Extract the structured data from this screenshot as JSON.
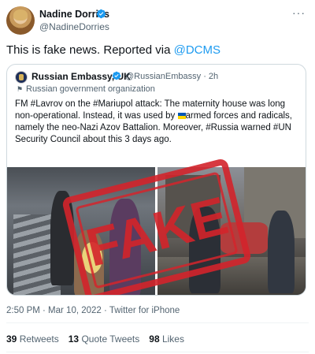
{
  "author": {
    "name": "Nadine Dorries",
    "handle": "@NadineDorries"
  },
  "tweet": {
    "text_before_mention": "This is fake news. Reported via ",
    "mention": "@DCMS"
  },
  "quoted_tweet": {
    "name": "Russian Embassy, UK",
    "handle_time": "@RussianEmbassy · 2h",
    "label": "Russian government organization",
    "body_part1": "FM #Lavrov on the #Mariupol attack: The maternity house was long non-operational. Instead, it was used by ",
    "body_part2": "armed forces and radicals, namely the neo-Nazi Azov Battalion. Moreover, #Russia warned #UN Security Council about this 3 days ago.",
    "stamp_text": "FAKE"
  },
  "meta": {
    "timestamp": "2:50 PM · Mar 10, 2022 · Twitter for iPhone"
  },
  "stats": {
    "retweets_count": "39",
    "retweets_label": "Retweets",
    "quotes_count": "13",
    "quotes_label": "Quote Tweets",
    "likes_count": "98",
    "likes_label": "Likes"
  },
  "icons": {
    "more": "more-icon",
    "verified": "verified-badge-icon",
    "flag": "flag-icon"
  },
  "colors": {
    "accent": "#1d9bf0",
    "stamp": "#d3242b"
  }
}
